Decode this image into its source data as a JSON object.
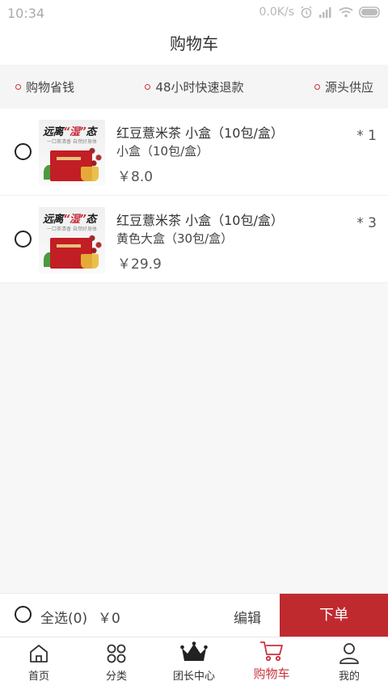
{
  "status": {
    "time": "10:34",
    "speed": "0.0K/s"
  },
  "header": {
    "title": "购物车"
  },
  "features": [
    {
      "label": "购物省钱"
    },
    {
      "label": "48小时快速退款"
    },
    {
      "label": "源头供应"
    }
  ],
  "items": [
    {
      "name": "红豆薏米茶 小盒（10包/盒）",
      "spec": "小盒（10包/盒）",
      "price": "￥8.0",
      "qty": "* 1",
      "image": {
        "slogan_pre": "远离",
        "slogan_em": "“湿”",
        "slogan_post": "态",
        "sub": "一口茶清香 自然好身体"
      }
    },
    {
      "name": "红豆薏米茶 小盒（10包/盒）",
      "spec": "黄色大盒（30包/盒）",
      "price": "￥29.9",
      "qty": "* 3",
      "image": {
        "slogan_pre": "远离",
        "slogan_em": "“湿”",
        "slogan_post": "态",
        "sub": "一口茶清香 自然好身体"
      }
    }
  ],
  "footer": {
    "select_all": "全选(0)",
    "total": "￥0",
    "edit": "编辑",
    "order": "下单"
  },
  "tabs": [
    {
      "label": "首页",
      "icon": "home-icon"
    },
    {
      "label": "分类",
      "icon": "category-icon"
    },
    {
      "label": "团长中心",
      "icon": "crown-icon"
    },
    {
      "label": "购物车",
      "icon": "cart-icon",
      "active": true
    },
    {
      "label": "我的",
      "icon": "user-icon"
    }
  ],
  "colors": {
    "accent": "#bf2a2f",
    "active_tab": "#c8323e"
  }
}
